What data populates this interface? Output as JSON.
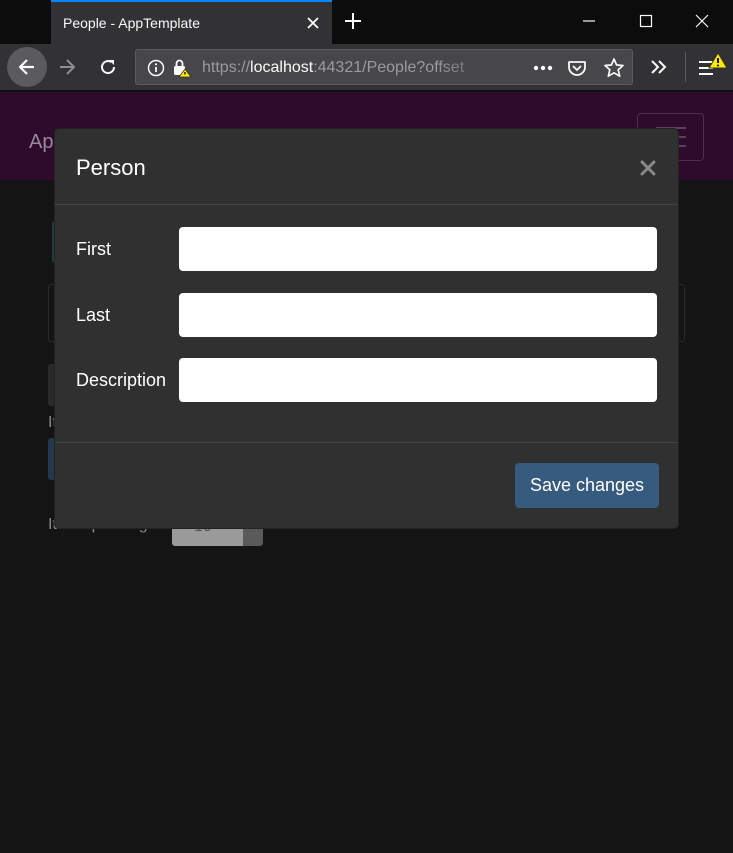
{
  "browser": {
    "tab_title": "People - AppTemplate",
    "url_prefix": "https://",
    "url_host": "localhost",
    "url_path": ":44321/People?offset"
  },
  "page": {
    "brand": "Ap",
    "items_per_page_label": "Items per Page",
    "items_per_page_value": "10",
    "items_label_fragment": "It"
  },
  "modal": {
    "title": "Person",
    "fields": [
      {
        "label": "First",
        "value": ""
      },
      {
        "label": "Last",
        "value": ""
      },
      {
        "label": "Description",
        "value": ""
      }
    ],
    "save_label": "Save changes"
  },
  "colors": {
    "header_bg": "#2e0b2c",
    "modal_bg": "#303030",
    "primary": "#375a7f",
    "tab_accent": "#0a84ff",
    "warning": "#ffe900"
  }
}
